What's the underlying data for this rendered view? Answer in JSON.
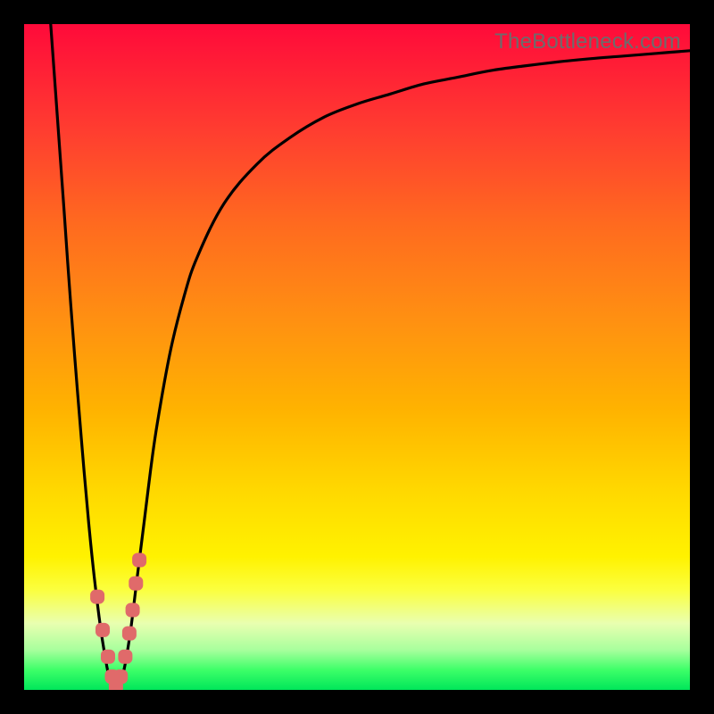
{
  "watermark": "TheBottleneck.com",
  "colors": {
    "background": "#000000",
    "curve": "#000000",
    "marker": "#e06a6a",
    "gradient_top": "#ff0a3a",
    "gradient_bottom": "#00e65a"
  },
  "chart_data": {
    "type": "line",
    "title": "",
    "xlabel": "",
    "ylabel": "",
    "xlim": [
      0,
      100
    ],
    "ylim": [
      0,
      100
    ],
    "series": [
      {
        "name": "bottleneck-curve",
        "x": [
          4,
          5,
          6,
          7,
          8,
          9,
          10,
          11,
          12,
          13,
          14,
          15,
          16,
          17,
          18,
          19,
          20,
          22,
          24,
          26,
          30,
          35,
          40,
          45,
          50,
          55,
          60,
          65,
          70,
          75,
          80,
          85,
          90,
          95,
          100
        ],
        "y": [
          100,
          86,
          72,
          58,
          45,
          33,
          22,
          13,
          6,
          1,
          0,
          3,
          9,
          17,
          25,
          33,
          40,
          51,
          59,
          65,
          73,
          79,
          83,
          86,
          88,
          89.5,
          91,
          92,
          93,
          93.7,
          94.3,
          94.8,
          95.2,
          95.6,
          96
        ]
      }
    ],
    "markers": {
      "name": "highlighted-points",
      "x": [
        11.0,
        11.8,
        12.6,
        13.2,
        13.8,
        14.5,
        15.2,
        15.8,
        16.3,
        16.8,
        17.3
      ],
      "y": [
        14.0,
        9.0,
        5.0,
        2.0,
        0.5,
        2.0,
        5.0,
        8.5,
        12.0,
        16.0,
        19.5
      ]
    }
  }
}
